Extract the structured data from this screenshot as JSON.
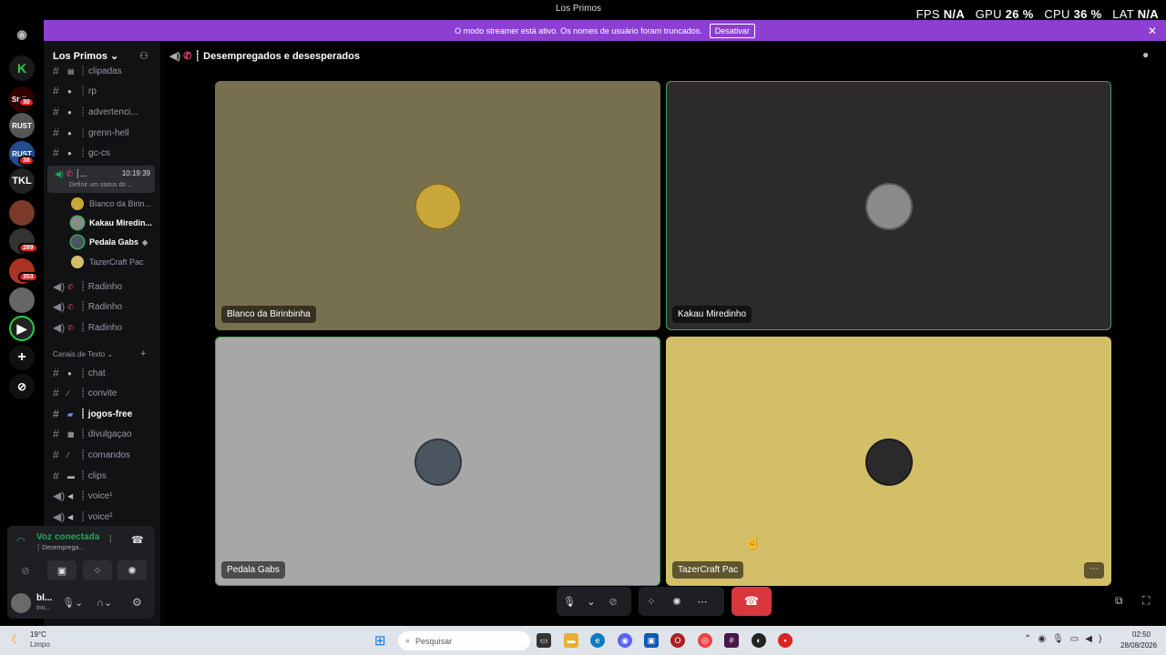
{
  "window": {
    "title": "Los Primos"
  },
  "overlay": {
    "fps_label": "FPS",
    "fps_value": "N/A",
    "gpu_label": "GPU",
    "gpu_value": "26 %",
    "cpu_label": "CPU",
    "cpu_value": "36 %",
    "lat_label": "LAT",
    "lat_value": "N/A"
  },
  "streamer_bar": {
    "message": "O modo streamer está ativo. Os nomes de usuário foram truncados.",
    "button": "Desativar"
  },
  "server_rail": {
    "badges": [
      "30",
      "38",
      "289",
      "353"
    ]
  },
  "sidebar": {
    "server_name": "Los Primos",
    "channels_top": [
      {
        "name": "clipadas",
        "sep": "┊"
      },
      {
        "name": "rp",
        "sep": "┊"
      },
      {
        "name": "advertenci...",
        "sep": "┊"
      },
      {
        "name": "grenn-hell",
        "sep": "┊"
      },
      {
        "name": "gc-cs",
        "sep": "┊"
      }
    ],
    "active_voice": {
      "name": "┊...",
      "time": "10:19:39",
      "status": "Definir um status do ..."
    },
    "members": [
      "Blanco da Birin...",
      "Kakau Miredin...",
      "Pedala Gabs",
      "TazerCraft Pac"
    ],
    "voice_channels": [
      "┊ Radinho",
      "┊ Radinho",
      "┊ Radinho"
    ],
    "category": "Canais de Texto",
    "text_channels": [
      "┊ chat",
      "┊ convite",
      "┊ jogos-free",
      "┊ divulgaçao",
      "┊ comandos",
      "┊ clips",
      "┊ voice¹",
      "┊ voice²"
    ]
  },
  "voice_panel": {
    "status": "Voz conectada",
    "channel": "┊ Desempregа..."
  },
  "user": {
    "name": "bl...",
    "status": "Inv..."
  },
  "channel_header": {
    "title": "┊ Desempregados e desesperados"
  },
  "tiles": [
    {
      "name": "Blanco da Birinbinha",
      "bg": "#77704f",
      "avatar": "#c9a63a",
      "speaking": false
    },
    {
      "name": "Kakau Miredinho",
      "bg": "#2c2a2a",
      "avatar": "#8a8a8a",
      "speaking": true
    },
    {
      "name": "Pedala Gabs",
      "bg": "#a7a7a7",
      "avatar": "#4a5560",
      "speaking": true
    },
    {
      "name": "TazerCraft Pac",
      "bg": "#d2bf68",
      "avatar": "#2a2a2a",
      "speaking": false
    }
  ],
  "taskbar": {
    "weather_temp": "19°C",
    "weather_cond": "Limpo",
    "search_placeholder": "Pesquisar",
    "time": "02:50",
    "date": "28/08/2026"
  },
  "colors": {
    "accent": "#8c3fd1",
    "speaking": "#3ba55d",
    "hangup": "#da373c"
  }
}
